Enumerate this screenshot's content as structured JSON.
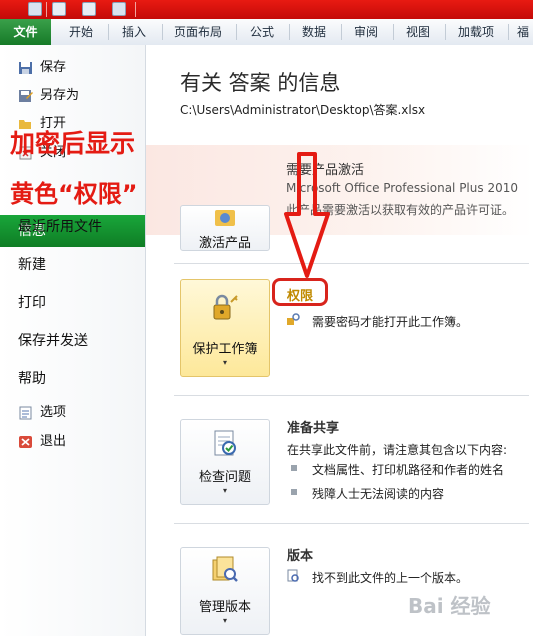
{
  "ribbon": {
    "file_tab": "文件",
    "tabs": [
      "开始",
      "插入",
      "页面布局",
      "公式",
      "数据",
      "审阅",
      "视图",
      "加载项",
      "福"
    ]
  },
  "nav": {
    "save": "保存",
    "save_as": "另存为",
    "open": "打开",
    "close": "关闭",
    "info": "信息",
    "recent": "最近所用文件",
    "new": "新建",
    "print": "打印",
    "save_send": "保存并发送",
    "help": "帮助",
    "options": "选项",
    "exit": "退出"
  },
  "info": {
    "title": "有关 答案 的信息",
    "path": "C:\\Users\\Administrator\\Desktop\\答案.xlsx"
  },
  "product": {
    "heading": "需要产品激活",
    "name": "Microsoft Office Professional Plus 2010",
    "message": "此产品需要激活以获取有效的产品许可证。",
    "button_label": "激活产品"
  },
  "permissions": {
    "title": "权限",
    "text": "需要密码才能打开此工作簿。",
    "button_label": "保护工作簿",
    "caret": "▾"
  },
  "prepare": {
    "title": "准备共享",
    "text": "在共享此文件前，请注意其包含以下内容:",
    "bullets": [
      "文档属性、打印机路径和作者的姓名",
      "残障人士无法阅读的内容"
    ],
    "button_label": "检查问题",
    "caret": "▾"
  },
  "versions": {
    "title": "版本",
    "text": "找不到此文件的上一个版本。",
    "button_label": "管理版本",
    "caret": "▾"
  },
  "annotation": {
    "line1": "加密后显示",
    "line2": "黄色“权限”"
  },
  "watermark": "Bai 经验",
  "colors": {
    "title_bar": "#e81a12",
    "file_tab": "#1e8f33",
    "annotation": "#e41b13",
    "highlight_yellow": "#fde89a"
  }
}
